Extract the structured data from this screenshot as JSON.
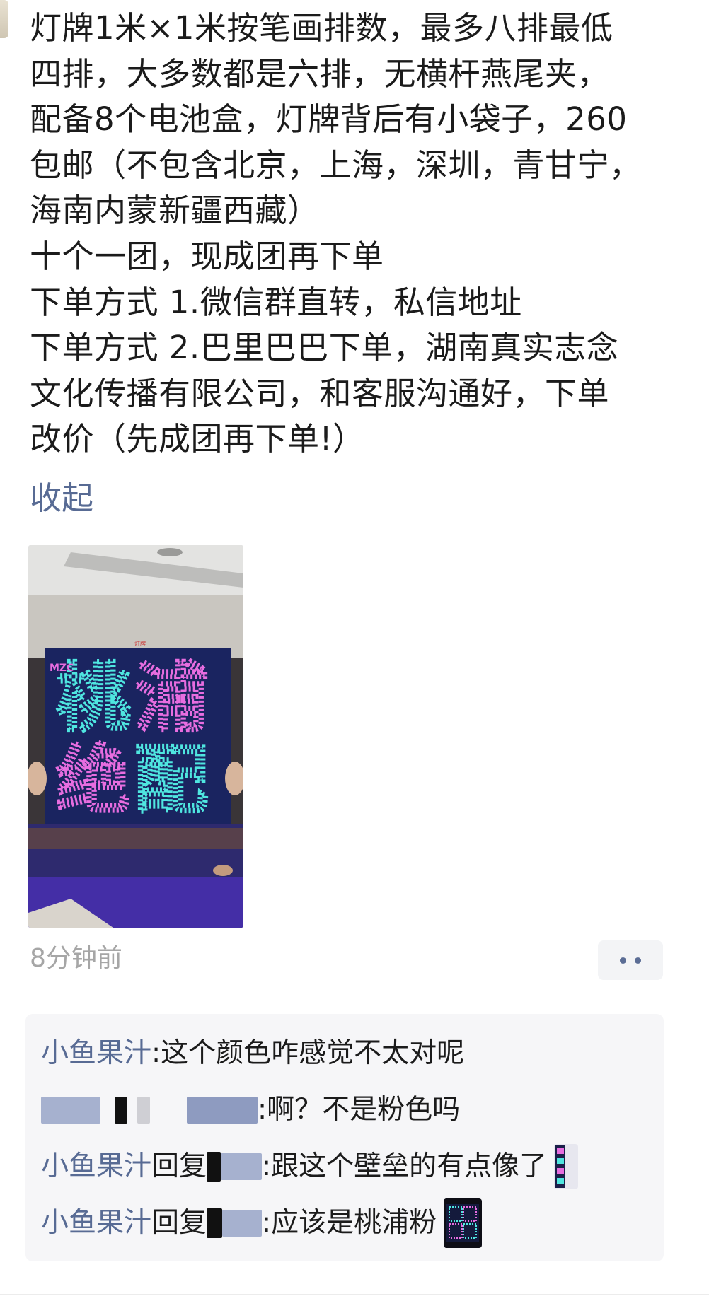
{
  "post": {
    "text": "灯牌1米×1米按笔画排数，最多八排最低\n四排，大多数都是六排，无横杆燕尾夹，\n配备8个电池盒，灯牌背后有小袋子，260\n包邮（不包含北京，上海，深圳，青甘宁，\n海南内蒙新疆西藏）\n十个一团，现成团再下单\n下单方式 1.微信群直转，私信地址\n下单方式 2.巴里巴巴下单，湖南真实志念\n文化传播有限公司，和客服沟通好，下单\n改价（先成团再下单!）",
    "collapse_label": "收起",
    "timestamp": "8分钟前",
    "photo": {
      "sign_top_left": "桃",
      "sign_top_right": "浦",
      "sign_bottom_left": "绝",
      "sign_bottom_right": "配",
      "side_tag": "MZC",
      "sign_colors": {
        "cyan": "#4fe6e0",
        "pink": "#e86de0",
        "magenta": "#c04ad6",
        "board": "#1a2460"
      }
    }
  },
  "comments": [
    {
      "name": "小鱼果汁",
      "colon": ":",
      "text": "这个颜色咋感觉不太对呢"
    },
    {
      "name": "",
      "colon": ":",
      "text": "啊？不是粉色吗"
    },
    {
      "name": "小鱼果汁",
      "reply_word": "回复",
      "colon": ":",
      "text": "跟这个壁垒的有点像了"
    },
    {
      "name": "小鱼果汁",
      "reply_word": "回复",
      "colon": ":",
      "text": "应该是桃浦粉"
    }
  ],
  "colors": {
    "link": "#586b94",
    "text": "#1b1b1b",
    "muted": "#a6a6a6",
    "panel": "#f6f6f8"
  }
}
